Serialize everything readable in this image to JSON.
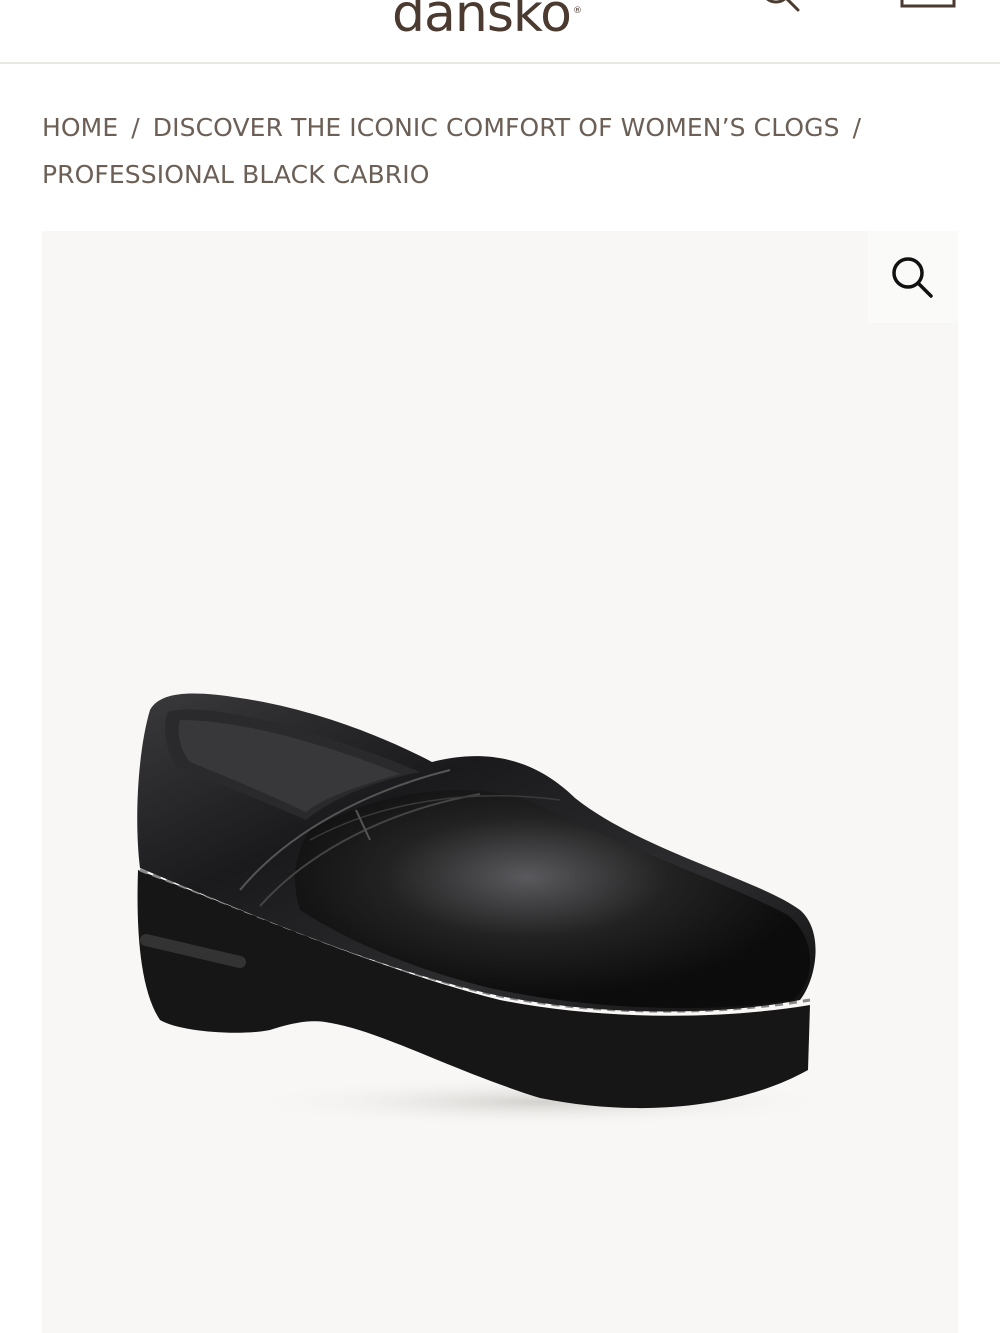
{
  "header": {
    "logo_text": "dansko",
    "logo_mark": "®",
    "search_icon": "search-icon",
    "cart_icon": "bag-icon"
  },
  "breadcrumb": {
    "items": [
      "HOME",
      "DISCOVER THE ICONIC COMFORT OF WOMEN’S CLOGS",
      "PROFESSIONAL BLACK CABRIO"
    ],
    "separator": "/"
  },
  "product_image": {
    "zoom_icon": "zoom-icon"
  },
  "colors": {
    "brand_brown": "#4a3a30",
    "breadcrumb_text": "#6b5f56",
    "image_bg": "#f8f7f5"
  }
}
